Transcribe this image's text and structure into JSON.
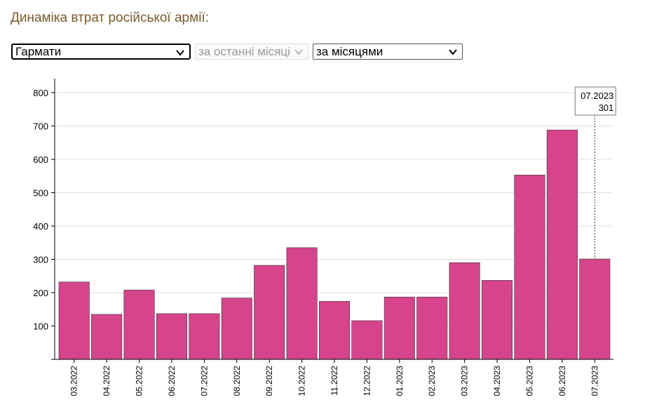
{
  "page": {
    "title": "Динаміка втрат російської армії:"
  },
  "controls": {
    "category_select": "Гармати",
    "period_select": "за останні місяці",
    "grouping_select": "за місяцями"
  },
  "icons": {
    "dropdown": "chevron-down-icon"
  },
  "colors": {
    "bar": "#d6448b",
    "title": "#7a5c2e",
    "grid": "#dddddd"
  },
  "chart_data": {
    "type": "bar",
    "categories": [
      "03.2022",
      "04.2022",
      "05.2022",
      "06.2022",
      "07.2022",
      "08.2022",
      "09.2022",
      "10.2022",
      "11.2022",
      "12.2022",
      "01.2023",
      "02.2023",
      "03.2023",
      "04.2023",
      "05.2023",
      "06.2023",
      "07.2023"
    ],
    "values": [
      232,
      135,
      208,
      137,
      137,
      184,
      282,
      335,
      174,
      116,
      187,
      187,
      290,
      237,
      553,
      688,
      301
    ],
    "yticks": [
      100,
      200,
      300,
      400,
      500,
      600,
      700,
      800
    ],
    "ylim": [
      0,
      840
    ],
    "grid": true,
    "tooltip": {
      "label": "07.2023",
      "value": "301"
    }
  }
}
